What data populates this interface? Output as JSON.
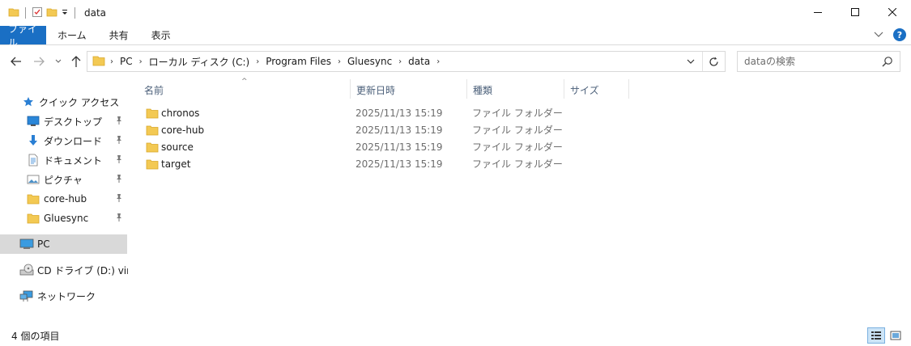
{
  "window": {
    "title": "data",
    "minimize_glyph": "—",
    "maximize_glyph": "☐",
    "close_glyph": "✕"
  },
  "ribbon": {
    "tabs": [
      {
        "label": "ファイル",
        "active": true
      },
      {
        "label": "ホーム"
      },
      {
        "label": "共有"
      },
      {
        "label": "表示"
      }
    ],
    "help_glyph": "?"
  },
  "address": {
    "crumbs": [
      "PC",
      "ローカル ディスク (C:)",
      "Program Files",
      "Gluesync",
      "data"
    ]
  },
  "search": {
    "placeholder": "dataの検索"
  },
  "sidebar": {
    "items": [
      {
        "label": "クイック アクセス",
        "icon": "star-icon",
        "pinned": false
      },
      {
        "label": "デスクトップ",
        "icon": "desktop-icon",
        "pinned": true
      },
      {
        "label": "ダウンロード",
        "icon": "download-icon",
        "pinned": true
      },
      {
        "label": "ドキュメント",
        "icon": "document-icon",
        "pinned": true
      },
      {
        "label": "ピクチャ",
        "icon": "pictures-icon",
        "pinned": true
      },
      {
        "label": "core-hub",
        "icon": "folder-icon",
        "pinned": true
      },
      {
        "label": "Gluesync",
        "icon": "folder-icon",
        "pinned": true
      },
      {
        "label": "PC",
        "icon": "pc-icon",
        "selected": true
      },
      {
        "label": "CD ドライブ (D:) virtio-w",
        "icon": "cd-drive-icon"
      },
      {
        "label": "ネットワーク",
        "icon": "network-icon"
      }
    ]
  },
  "list": {
    "columns": {
      "name": "名前",
      "date": "更新日時",
      "type": "種類",
      "size": "サイズ"
    },
    "rows": [
      {
        "name": "chronos",
        "date": "2025/11/13 15:19",
        "type": "ファイル フォルダー"
      },
      {
        "name": "core-hub",
        "date": "2025/11/13 15:19",
        "type": "ファイル フォルダー"
      },
      {
        "name": "source",
        "date": "2025/11/13 15:19",
        "type": "ファイル フォルダー"
      },
      {
        "name": "target",
        "date": "2025/11/13 15:19",
        "type": "ファイル フォルダー"
      }
    ]
  },
  "status": {
    "count": "4 個の項目"
  },
  "colors": {
    "accent": "#1a6fc4",
    "folder": "#f3c953",
    "selected_bg": "#d9d9d9"
  }
}
